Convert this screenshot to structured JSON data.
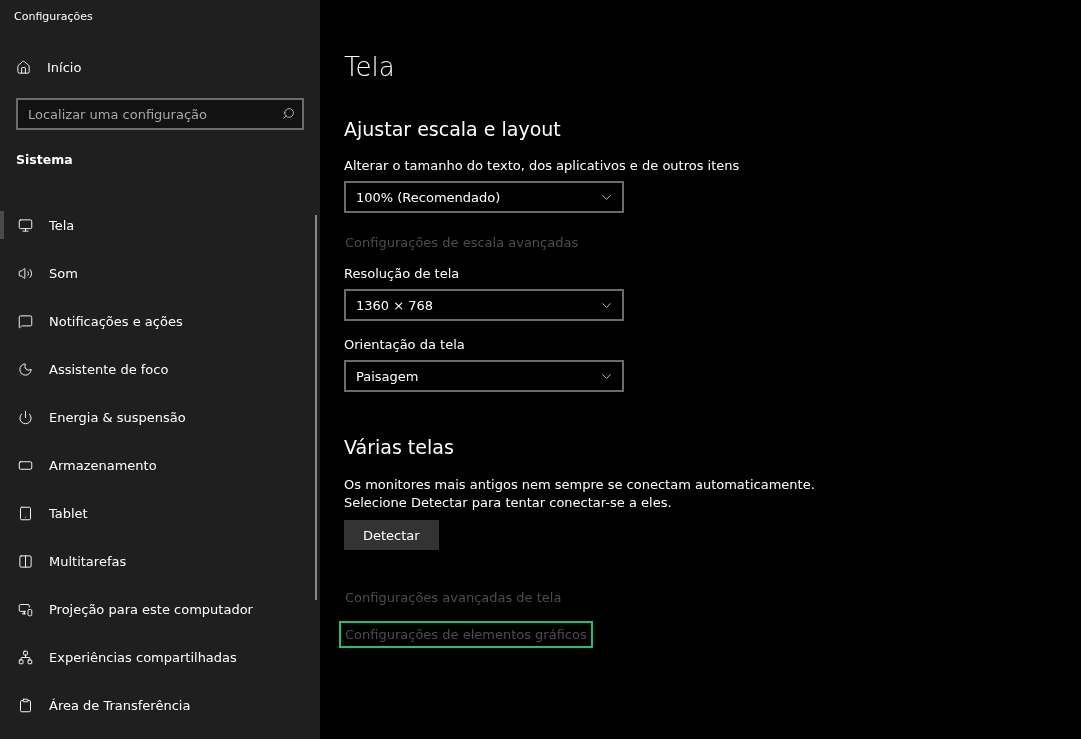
{
  "window": {
    "title": "Configurações"
  },
  "sidebar": {
    "home": "Início",
    "search": {
      "placeholder": "Localizar uma configuração"
    },
    "section": "Sistema",
    "items": [
      {
        "label": "Tela",
        "selected": true
      },
      {
        "label": "Som",
        "selected": false
      },
      {
        "label": "Notificações e ações",
        "selected": false
      },
      {
        "label": "Assistente de foco",
        "selected": false
      },
      {
        "label": "Energia & suspensão",
        "selected": false
      },
      {
        "label": "Armazenamento",
        "selected": false
      },
      {
        "label": "Tablet",
        "selected": false
      },
      {
        "label": "Multitarefas",
        "selected": false
      },
      {
        "label": "Projeção para este computador",
        "selected": false
      },
      {
        "label": "Experiências compartilhadas",
        "selected": false
      },
      {
        "label": "Área de Transferência",
        "selected": false
      }
    ]
  },
  "page": {
    "title": "Tela",
    "sections": [
      {
        "heading": "Ajustar escala e layout",
        "items": [
          {
            "kind": "dropdown",
            "label": "Alterar o tamanho do texto, dos aplicativos e de outros itens",
            "value": "100% (Recomendado)"
          },
          {
            "kind": "link",
            "text": "Configurações de escala avançadas",
            "highlighted": false
          },
          {
            "kind": "dropdown",
            "label": "Resolução de tela",
            "value": "1360 × 768"
          },
          {
            "kind": "dropdown",
            "label": "Orientação da tela",
            "value": "Paisagem"
          }
        ]
      },
      {
        "heading": "Várias telas",
        "items": [
          {
            "kind": "text",
            "text": "Os monitores mais antigos nem sempre se conectam automaticamente.\nSelecione Detectar para tentar conectar-se a eles."
          },
          {
            "kind": "button",
            "text": "Detectar"
          },
          {
            "kind": "link",
            "text": "Configurações avançadas de tela",
            "highlighted": false
          },
          {
            "kind": "link",
            "text": "Configurações de elementos gráficos",
            "highlighted": true
          }
        ]
      }
    ]
  }
}
